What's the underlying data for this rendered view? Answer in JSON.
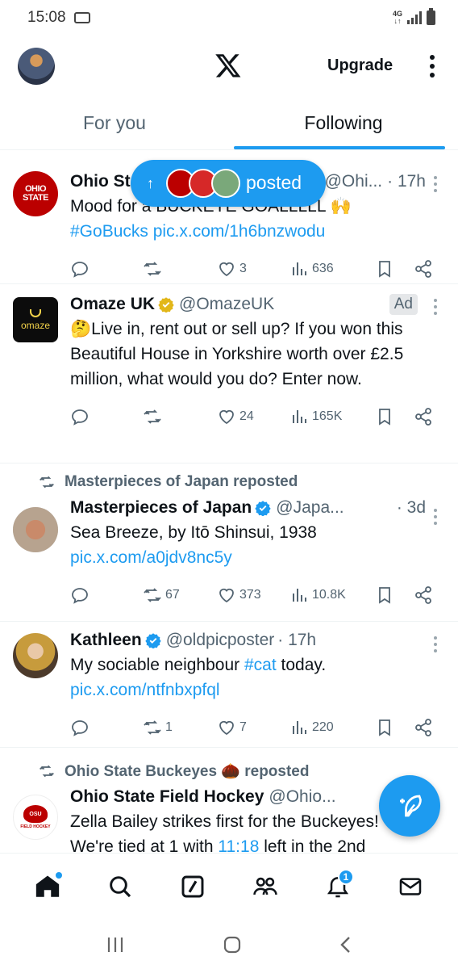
{
  "status_bar": {
    "time": "15:08",
    "network": "4G"
  },
  "header": {
    "upgrade_label": "Upgrade"
  },
  "tabs": [
    {
      "label": "For you",
      "active": false
    },
    {
      "label": "Following",
      "active": true
    }
  ],
  "new_posts_pill": {
    "label": "posted"
  },
  "tweets": [
    {
      "name": "Ohio St",
      "handle": "@Ohi...",
      "time": "· 17h",
      "text_plain": "Mood for a BUCKEYE GOALLLLL 🙌",
      "hashtag": "#GoBucks",
      "link": "pic.x.com/1h6bnzwodu",
      "likes": "3",
      "views": "636"
    },
    {
      "name": "Omaze UK",
      "handle": "@OmazeUK",
      "ad_label": "Ad",
      "avatar_label": "omaze",
      "text": "🤔Live in, rent out or sell up? If you won this Beautiful House in Yorkshire worth over £2.5 million, what would you do? Enter now.",
      "likes": "24",
      "views": "165K"
    },
    {
      "reposted_by": "Masterpieces of Japan reposted",
      "name": "Masterpieces of Japan",
      "handle": "@Japa...",
      "time": "· 3d",
      "text": "Sea Breeze, by Itō Shinsui, 1938",
      "link": "pic.x.com/a0jdv8nc5y",
      "reposts": "67",
      "likes": "373",
      "views": "10.8K"
    },
    {
      "name": "Kathleen",
      "handle": "@oldpicposter",
      "time": "· 17h",
      "text_before": "My sociable neighbour ",
      "hashtag": "#cat",
      "text_after": " today.",
      "link": "pic.x.com/ntfnbxpfql",
      "reposts": "1",
      "likes": "7",
      "views": "220"
    },
    {
      "reposted_by": "Ohio State Buckeyes 🌰 reposted",
      "name": "Ohio State Field Hockey",
      "handle": "@Ohio...",
      "avatar_label": "FIELD HOCKEY",
      "line1": "Zella Bailey strikes first for the Buckeyes!",
      "line2_before": "We're tied at 1 with ",
      "line2_link": "11:18",
      "line2_after": " left in the 2nd"
    }
  ],
  "bottom_nav": {
    "notifications_count": "1"
  },
  "colors": {
    "accent": "#1d9bf0",
    "osu_red": "#bb0000",
    "text_secondary": "#536471"
  }
}
